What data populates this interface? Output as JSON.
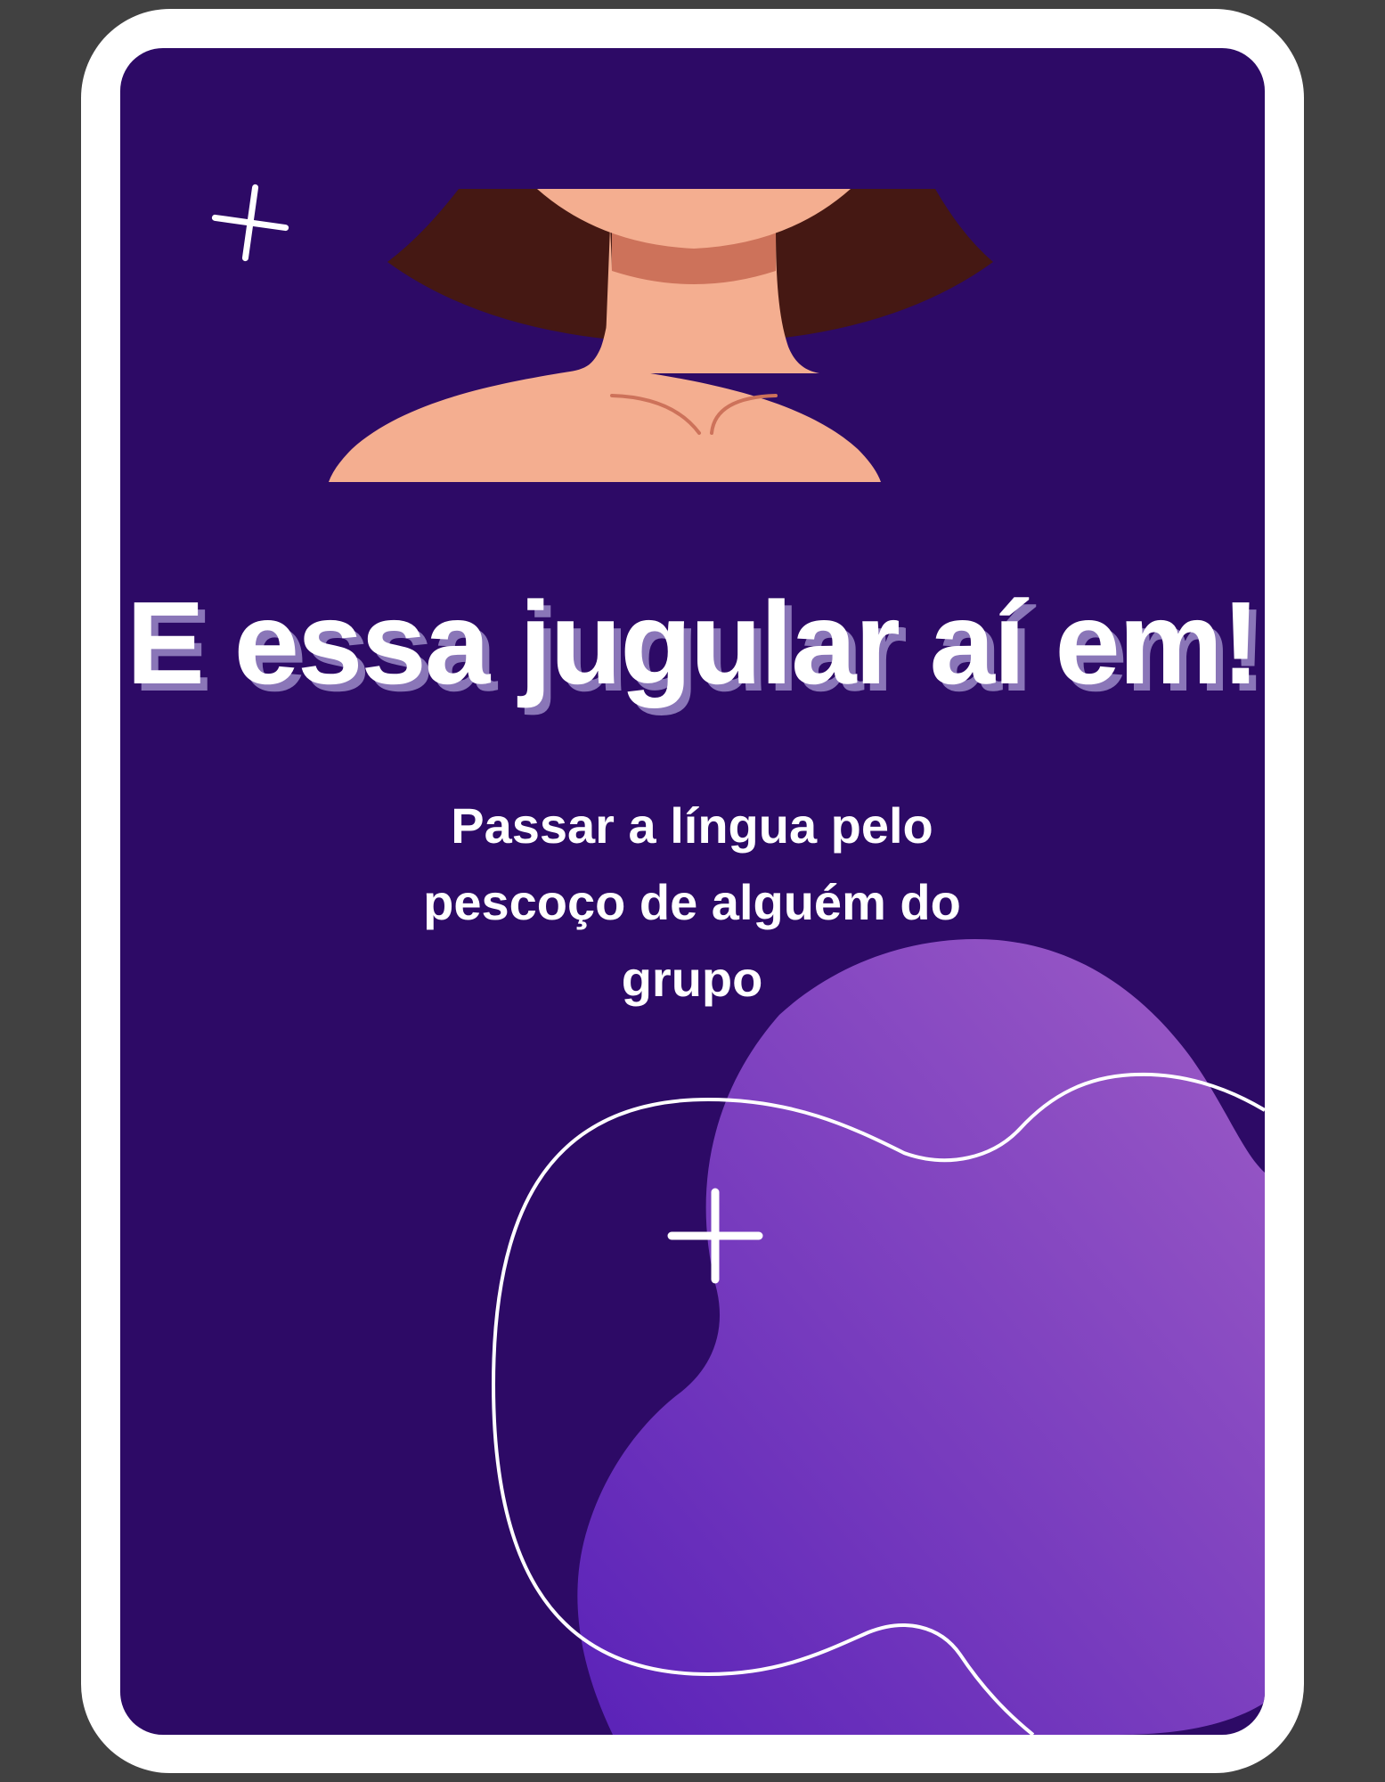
{
  "card": {
    "title": "E essa jugular aí em!",
    "subtitle": "Passar a língua pelo pescoço de alguém do grupo"
  },
  "illustration": {
    "subject": "neck-illustration",
    "icons": [
      "sparkle-plus-icon",
      "plus-icon"
    ]
  },
  "colors": {
    "page_background": "#414141",
    "card_border": "#ffffff",
    "card_background": "#2d0a66",
    "blob_gradient_start": "#5a22b8",
    "blob_gradient_end": "#9d5cc6",
    "skin": "#f4ae90",
    "skin_shadow": "#cd725a",
    "hair": "#451813",
    "title_shadow": "#8a76b8",
    "text": "#ffffff"
  }
}
